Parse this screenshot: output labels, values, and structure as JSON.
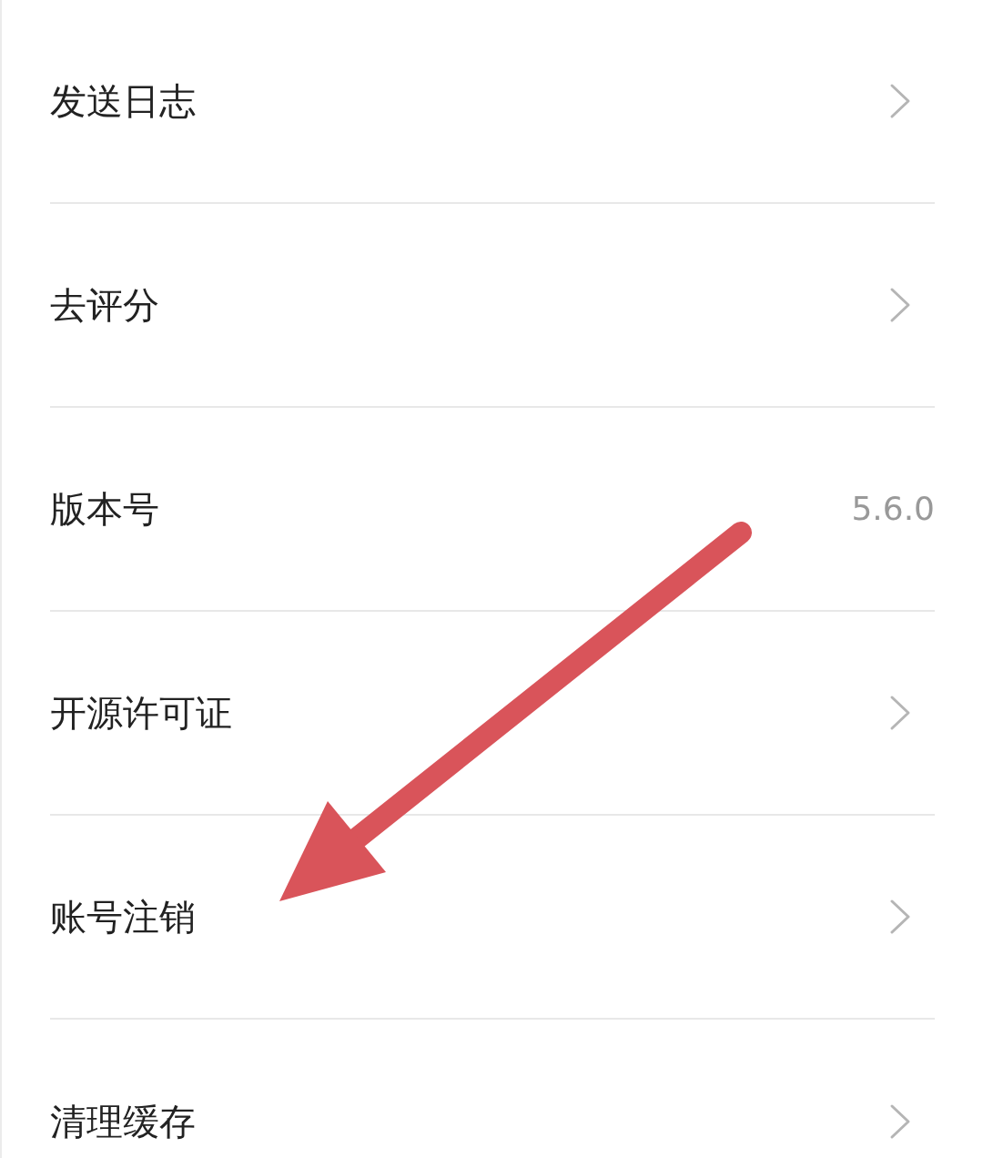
{
  "settings": [
    {
      "label": "发送日志",
      "kind": "link"
    },
    {
      "label": "去评分",
      "kind": "link"
    },
    {
      "label": "版本号",
      "kind": "value",
      "value": "5.6.0"
    },
    {
      "label": "开源许可证",
      "kind": "link"
    },
    {
      "label": "账号注销",
      "kind": "link"
    },
    {
      "label": "清理缓存",
      "kind": "link"
    }
  ],
  "annotation": {
    "kind": "arrow"
  }
}
